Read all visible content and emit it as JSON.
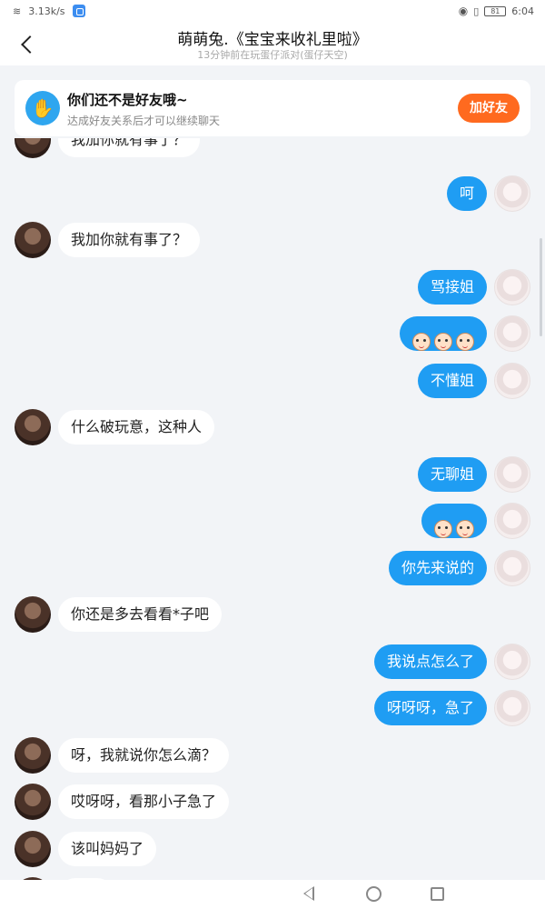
{
  "status_bar": {
    "net_speed": "3.13k/s",
    "battery": "81",
    "time": "6:04"
  },
  "header": {
    "title": "萌萌兔.《宝宝来收礼里啦》",
    "subtitle": "13分钟前在玩蛋仔派对(蛋仔天空)"
  },
  "friend_banner": {
    "title": "你们还不是好友哦~",
    "subtitle": "达成好友关系后才可以继续聊天",
    "button": "加好友"
  },
  "messages": [
    {
      "side": "in",
      "text": "我加你就有事了？"
    },
    {
      "side": "out",
      "text": "呵"
    },
    {
      "side": "in",
      "text": "我加你就有事了？"
    },
    {
      "side": "out",
      "text": "骂接姐"
    },
    {
      "side": "out",
      "emoji": 3
    },
    {
      "side": "out",
      "text": "不懂姐"
    },
    {
      "side": "in",
      "text": "什么破玩意，这种人"
    },
    {
      "side": "out",
      "text": "无聊姐"
    },
    {
      "side": "out",
      "emoji": 2
    },
    {
      "side": "out",
      "text": "你先来说的"
    },
    {
      "side": "in",
      "text": "你还是多去看看*子吧"
    },
    {
      "side": "out",
      "text": "我说点怎么了"
    },
    {
      "side": "out",
      "text": "呀呀呀，急了"
    },
    {
      "side": "in",
      "text": "呀，我就说你怎么滴？"
    },
    {
      "side": "in",
      "text": "哎呀呀，看那小子急了"
    },
    {
      "side": "in",
      "text": "该叫妈妈了"
    },
    {
      "side": "in",
      "text": ""
    }
  ]
}
